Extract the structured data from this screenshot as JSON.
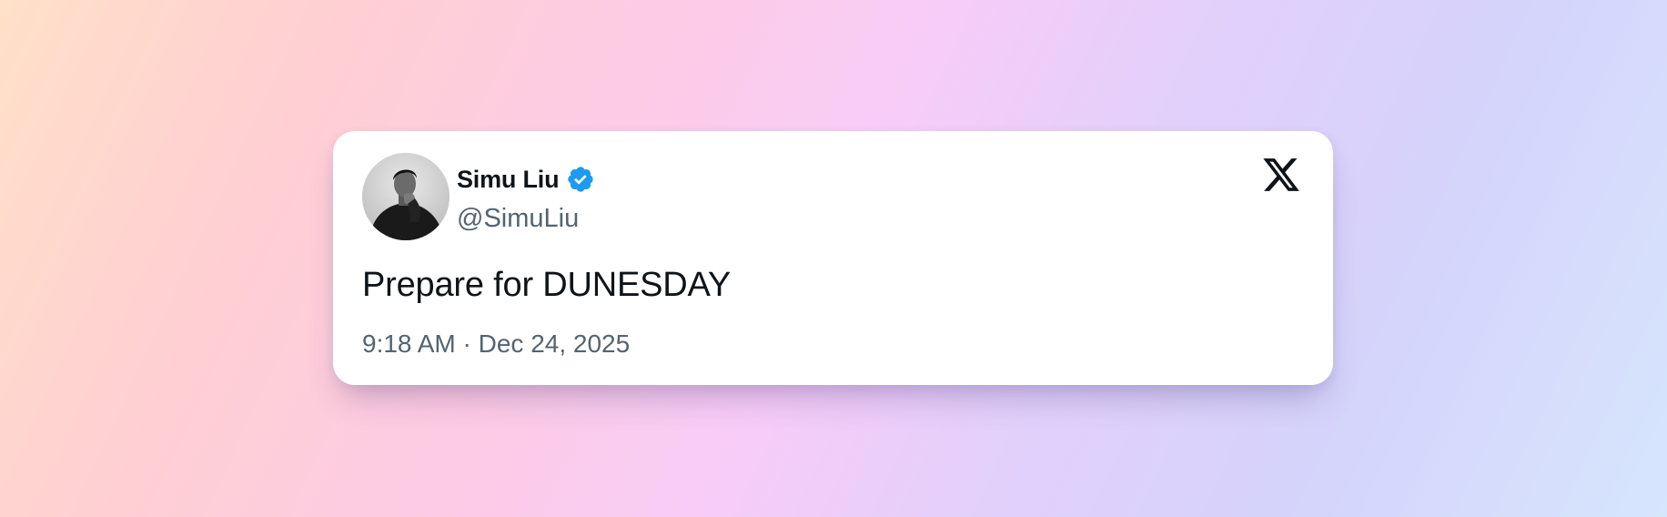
{
  "tweet": {
    "author": {
      "display_name": "Simu Liu",
      "handle": "@SimuLiu",
      "verified": true,
      "avatar": "profile-photo"
    },
    "text": "Prepare for DUNESDAY",
    "time": "9:18 AM",
    "separator": "·",
    "date": "Dec 24, 2025",
    "platform_icon": "x-logo-icon"
  },
  "colors": {
    "verified_badge": "#1d9bf0",
    "primary_text": "#0f1419",
    "secondary_text": "#536471",
    "card_background": "#ffffff"
  }
}
